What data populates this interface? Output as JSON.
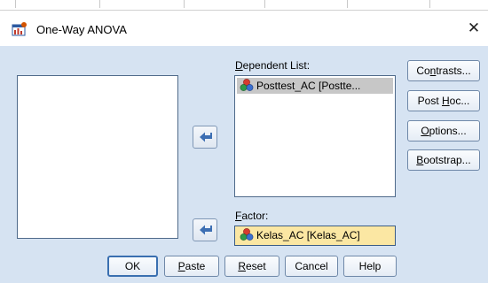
{
  "window": {
    "title": "One-Way ANOVA",
    "close_glyph": "✕"
  },
  "labels": {
    "dependent_list": {
      "mnemonic": "D",
      "rest": "ependent List:"
    },
    "factor": {
      "mnemonic": "F",
      "rest": "actor:"
    }
  },
  "dependent_list": {
    "items": [
      {
        "text": "Posttest_AC [Postte...",
        "icon": "scale-variable-icon"
      }
    ]
  },
  "factor": {
    "value": "Kelas_AC [Kelas_AC]",
    "icon": "nominal-variable-icon"
  },
  "side_buttons": {
    "contrasts": {
      "pre": "Co",
      "mn": "n",
      "post": "trasts..."
    },
    "post_hoc": {
      "pre": "Post ",
      "mn": "H",
      "post": "oc..."
    },
    "options": {
      "pre": "",
      "mn": "O",
      "post": "ptions..."
    },
    "bootstrap": {
      "pre": "",
      "mn": "B",
      "post": "ootstrap..."
    }
  },
  "bottom_buttons": {
    "ok": {
      "pre": "OK",
      "mn": "",
      "post": ""
    },
    "paste": {
      "pre": "",
      "mn": "P",
      "post": "aste"
    },
    "reset": {
      "pre": "",
      "mn": "R",
      "post": "eset"
    },
    "cancel": {
      "pre": "Cancel",
      "mn": "",
      "post": ""
    },
    "help": {
      "pre": "Help",
      "mn": "",
      "post": ""
    }
  },
  "colors": {
    "dialog_bg": "#d6e3f2",
    "factor_bg": "#fbe7a3",
    "selection_bg": "#c7c7c7",
    "arrow": "#3d6fb3"
  }
}
